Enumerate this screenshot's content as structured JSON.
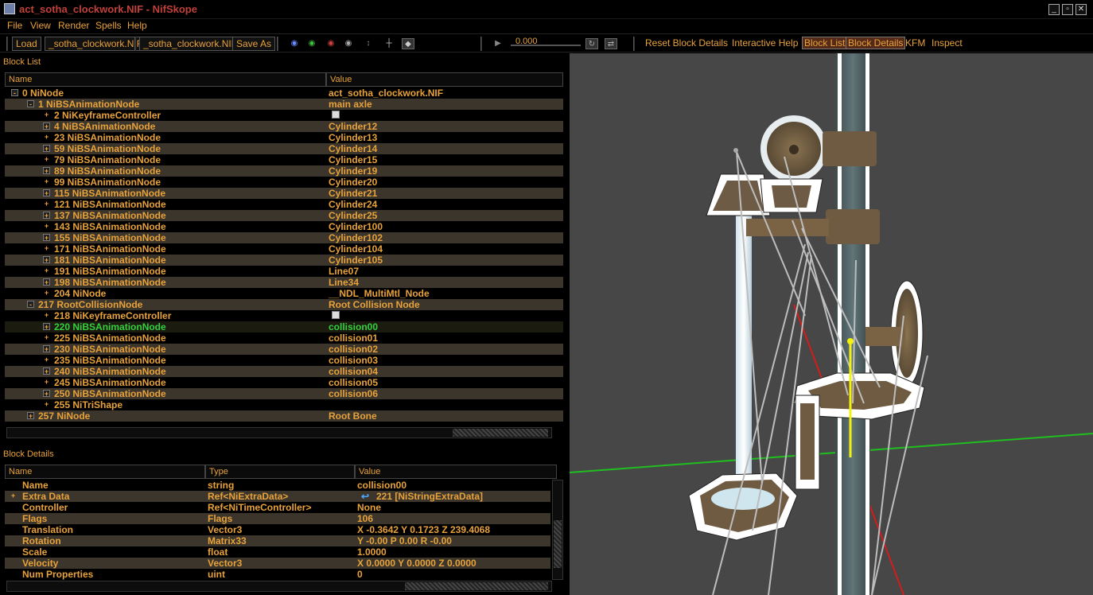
{
  "window": {
    "title": "act_sotha_clockwork.NIF - NifSkope"
  },
  "menu": {
    "file": "File",
    "view": "View",
    "render": "Render",
    "spells": "Spells",
    "help": "Help"
  },
  "toolbar": {
    "load": "Load",
    "load_file": "_sotha_clockwork.NIF",
    "save_file": "_sotha_clockwork.NIF",
    "save_as": "Save As",
    "time_value": "0.000",
    "reset_block_details": "Reset Block Details",
    "interactive_help": "Interactive Help",
    "block_list": "Block List",
    "block_details": "Block Details",
    "kfm": "KFM",
    "inspect": "Inspect"
  },
  "block_list": {
    "title": "Block List",
    "col_name": "Name",
    "col_value": "Value",
    "rows": [
      {
        "name": "0 NiNode",
        "value": "act_sotha_clockwork.NIF",
        "depth": 0,
        "exp": "-"
      },
      {
        "name": "1 NiBSAnimationNode",
        "value": "main axle",
        "depth": 1,
        "exp": "-"
      },
      {
        "name": "2 NiKeyframeController",
        "value": "",
        "depth": 2,
        "exp": "+",
        "icon": true
      },
      {
        "name": "4 NiBSAnimationNode",
        "value": "Cylinder12",
        "depth": 2,
        "exp": "+"
      },
      {
        "name": "23 NiBSAnimationNode",
        "value": "Cylinder13",
        "depth": 2,
        "exp": "+"
      },
      {
        "name": "59 NiBSAnimationNode",
        "value": "Cylinder14",
        "depth": 2,
        "exp": "+"
      },
      {
        "name": "79 NiBSAnimationNode",
        "value": "Cylinder15",
        "depth": 2,
        "exp": "+"
      },
      {
        "name": "89 NiBSAnimationNode",
        "value": "Cylinder19",
        "depth": 2,
        "exp": "+"
      },
      {
        "name": "99 NiBSAnimationNode",
        "value": "Cylinder20",
        "depth": 2,
        "exp": "+"
      },
      {
        "name": "115 NiBSAnimationNode",
        "value": "Cylinder21",
        "depth": 2,
        "exp": "+"
      },
      {
        "name": "121 NiBSAnimationNode",
        "value": "Cylinder24",
        "depth": 2,
        "exp": "+"
      },
      {
        "name": "137 NiBSAnimationNode",
        "value": "Cylinder25",
        "depth": 2,
        "exp": "+"
      },
      {
        "name": "143 NiBSAnimationNode",
        "value": "Cylinder100",
        "depth": 2,
        "exp": "+"
      },
      {
        "name": "155 NiBSAnimationNode",
        "value": "Cylinder102",
        "depth": 2,
        "exp": "+"
      },
      {
        "name": "171 NiBSAnimationNode",
        "value": "Cylinder104",
        "depth": 2,
        "exp": "+"
      },
      {
        "name": "181 NiBSAnimationNode",
        "value": "Cylinder105",
        "depth": 2,
        "exp": "+"
      },
      {
        "name": "191 NiBSAnimationNode",
        "value": "Line07",
        "depth": 2,
        "exp": "+"
      },
      {
        "name": "198 NiBSAnimationNode",
        "value": "Line34",
        "depth": 2,
        "exp": "+"
      },
      {
        "name": "204 NiNode",
        "value": "__NDL_MultiMtl_Node",
        "depth": 2,
        "exp": "+"
      },
      {
        "name": "217 RootCollisionNode",
        "value": "Root Collision Node",
        "depth": 1,
        "exp": "-"
      },
      {
        "name": "218 NiKeyframeController",
        "value": "",
        "depth": 2,
        "exp": "+",
        "icon": true
      },
      {
        "name": "220 NiBSAnimationNode",
        "value": "collision00",
        "depth": 2,
        "exp": "+",
        "selected": true
      },
      {
        "name": "225 NiBSAnimationNode",
        "value": "collision01",
        "depth": 2,
        "exp": "+"
      },
      {
        "name": "230 NiBSAnimationNode",
        "value": "collision02",
        "depth": 2,
        "exp": "+"
      },
      {
        "name": "235 NiBSAnimationNode",
        "value": "collision03",
        "depth": 2,
        "exp": "+"
      },
      {
        "name": "240 NiBSAnimationNode",
        "value": "collision04",
        "depth": 2,
        "exp": "+"
      },
      {
        "name": "245 NiBSAnimationNode",
        "value": "collision05",
        "depth": 2,
        "exp": "+"
      },
      {
        "name": "250 NiBSAnimationNode",
        "value": "collision06",
        "depth": 2,
        "exp": "+"
      },
      {
        "name": "255 NiTriShape",
        "value": "",
        "depth": 2,
        "exp": "+"
      },
      {
        "name": "257 NiNode",
        "value": "Root Bone",
        "depth": 1,
        "exp": "+"
      }
    ]
  },
  "block_details": {
    "title": "Block Details",
    "col_name": "Name",
    "col_type": "Type",
    "col_value": "Value",
    "rows": [
      {
        "name": "Name",
        "type": "string",
        "value": "collision00"
      },
      {
        "name": "Extra Data",
        "type": "Ref<NiExtraData>",
        "value": "221 [NiStringExtraData]",
        "exp": true,
        "link": true
      },
      {
        "name": "Controller",
        "type": "Ref<NiTimeController>",
        "value": "None"
      },
      {
        "name": "Flags",
        "type": "Flags",
        "value": "106"
      },
      {
        "name": "Translation",
        "type": "Vector3",
        "value": "X -0.3642 Y 0.1723 Z 239.4068"
      },
      {
        "name": "Rotation",
        "type": "Matrix33",
        "value": "Y -0.00 P 0.00 R -0.00"
      },
      {
        "name": "Scale",
        "type": "float",
        "value": "1.0000"
      },
      {
        "name": "Velocity",
        "type": "Vector3",
        "value": "X 0.0000 Y 0.0000 Z 0.0000"
      },
      {
        "name": "Num Properties",
        "type": "uint",
        "value": "0"
      }
    ]
  }
}
